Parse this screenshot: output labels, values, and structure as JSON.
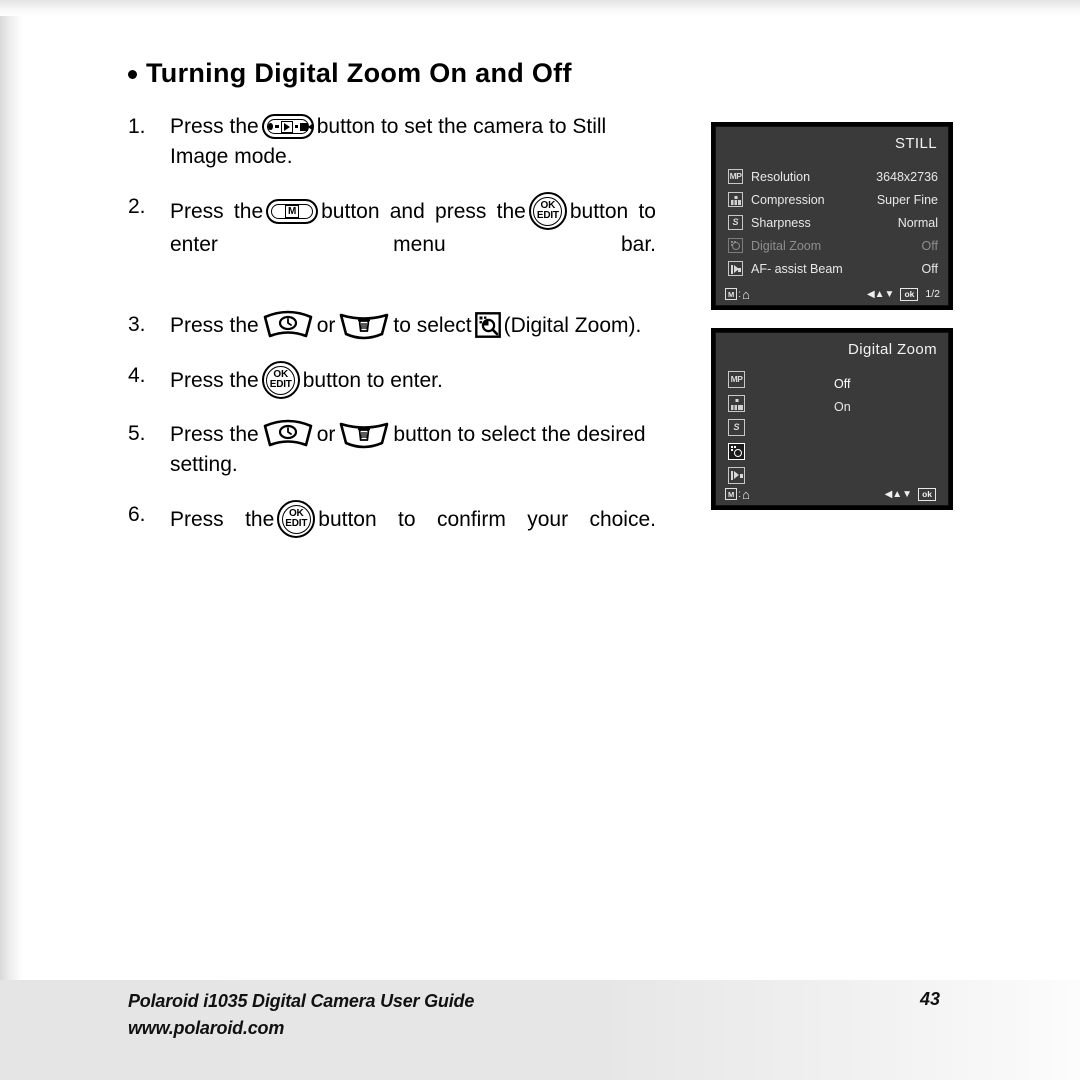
{
  "heading": "Turning Digital Zoom On and Off",
  "steps": [
    {
      "num": "1.",
      "pre": "Press the",
      "icon": "mode-button",
      "post": "button to set the camera to Still Image mode."
    },
    {
      "num": "2.",
      "pre": "Press the",
      "icon": "menu-button",
      "mid": "button and press the",
      "icon2": "ok-edit-button",
      "post": "button to enter menu bar."
    },
    {
      "num": "3.",
      "pre": "Press the",
      "icon": "up-timer-button",
      "mid_or": "or",
      "icon2": "down-delete-button",
      "mid": "to select",
      "icon3": "digital-zoom-icon",
      "post": "(Digital Zoom)."
    },
    {
      "num": "4.",
      "pre": "Press the",
      "icon": "ok-edit-button",
      "post": "button to enter."
    },
    {
      "num": "5.",
      "pre": "Press the",
      "icon": "up-timer-button",
      "mid_or": "or",
      "icon2": "down-delete-button",
      "post": "button to select the desired setting."
    },
    {
      "num": "6.",
      "pre": "Press the",
      "icon": "ok-edit-button",
      "post": "button to confirm your choice."
    }
  ],
  "button_labels": {
    "ok": "OK",
    "edit": "EDIT",
    "menu_m": "M"
  },
  "lcd_still": {
    "title": "STILL",
    "rows": [
      {
        "icon": "megapixel-icon",
        "label": "Resolution",
        "value": "3648x2736",
        "dim": false
      },
      {
        "icon": "compression-icon",
        "label": "Compression",
        "value": "Super Fine",
        "dim": false
      },
      {
        "icon": "sharpness-icon",
        "label": "Sharpness",
        "value": "Normal",
        "dim": false
      },
      {
        "icon": "digital-zoom-icon",
        "label": "Digital Zoom",
        "value": "Off",
        "dim": true
      },
      {
        "icon": "af-assist-icon",
        "label": "AF- assist Beam",
        "value": "Off",
        "dim": false
      }
    ],
    "status": {
      "m_label": "M",
      "colon": ":",
      "home_icon": "home-icon",
      "arrows": "◀▲▼",
      "ok_label": "ok",
      "page": "1/2"
    }
  },
  "lcd_zoom": {
    "title": "Digital Zoom",
    "rail_icons": [
      "megapixel-icon",
      "compression-icon",
      "sharpness-icon",
      "digital-zoom-icon",
      "af-assist-icon"
    ],
    "options": [
      {
        "label": "Off",
        "selected": true
      },
      {
        "label": "On",
        "selected": false
      }
    ],
    "status": {
      "m_label": "M",
      "colon": ":",
      "home_icon": "home-icon",
      "arrows": "◀▲▼",
      "ok_label": "ok"
    }
  },
  "footer": {
    "line1": "Polaroid i1035 Digital Camera User Guide",
    "line2": "www.polaroid.com",
    "page_number": "43"
  },
  "colors": {
    "lcd_background": "#3a3a3a",
    "lcd_frame": "#000000",
    "lcd_text": "#e8e8e8",
    "lcd_text_dim": "#8e8e8e",
    "page_background": "#ffffff",
    "footer_band": "#e6e6e6",
    "ink": "#000000"
  }
}
